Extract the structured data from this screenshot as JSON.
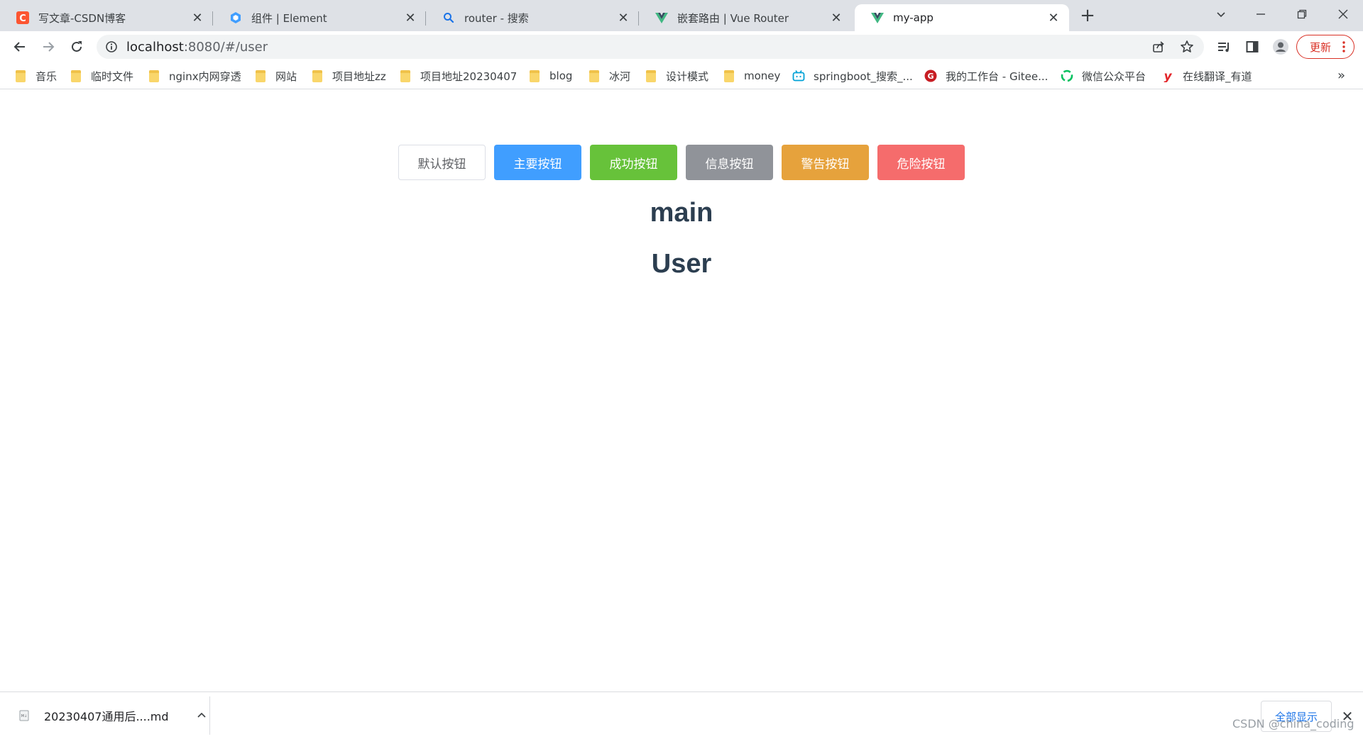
{
  "tabs": [
    {
      "title": "写文章-CSDN博客",
      "icon": "csdn-icon"
    },
    {
      "title": "组件 | Element",
      "icon": "element-icon"
    },
    {
      "title": "router - 搜索",
      "icon": "search-icon"
    },
    {
      "title": "嵌套路由 | Vue Router",
      "icon": "vue-icon"
    },
    {
      "title": "my-app",
      "icon": "vue-icon",
      "active": true
    }
  ],
  "address_bar": {
    "host": "localhost",
    "path": ":8080/#/user"
  },
  "update_button": {
    "label": "更新"
  },
  "bookmarks": [
    {
      "label": "音乐",
      "icon": "folder-icon"
    },
    {
      "label": "临时文件",
      "icon": "folder-icon"
    },
    {
      "label": "nginx内网穿透",
      "icon": "folder-icon"
    },
    {
      "label": "网站",
      "icon": "folder-icon"
    },
    {
      "label": "项目地址zz",
      "icon": "folder-icon"
    },
    {
      "label": "项目地址20230407",
      "icon": "folder-icon"
    },
    {
      "label": "blog",
      "icon": "folder-icon"
    },
    {
      "label": "冰河",
      "icon": "folder-icon"
    },
    {
      "label": "设计模式",
      "icon": "folder-icon"
    },
    {
      "label": "money",
      "icon": "folder-icon"
    },
    {
      "label": "springboot_搜索_...",
      "icon": "bilibili-icon"
    },
    {
      "label": "我的工作台 - Gitee...",
      "icon": "gitee-icon"
    },
    {
      "label": "微信公众平台",
      "icon": "wechat-icon"
    },
    {
      "label": "在线翻译_有道",
      "icon": "youdao-icon"
    }
  ],
  "page": {
    "buttons": [
      {
        "label": "默认按钮",
        "type": "default"
      },
      {
        "label": "主要按钮",
        "type": "primary"
      },
      {
        "label": "成功按钮",
        "type": "success"
      },
      {
        "label": "信息按钮",
        "type": "info"
      },
      {
        "label": "警告按钮",
        "type": "warning"
      },
      {
        "label": "危险按钮",
        "type": "danger"
      }
    ],
    "heading_main": "main",
    "heading_user": "User"
  },
  "downloads": {
    "file_name": "20230407通用后....md",
    "show_all_label": "全部显示"
  },
  "watermark": "CSDN @china_coding",
  "colors": {
    "primary": "#409eff",
    "success": "#67c23a",
    "info": "#909399",
    "warning": "#e6a23c",
    "danger": "#f56c6c",
    "heading": "#2c3e50"
  }
}
